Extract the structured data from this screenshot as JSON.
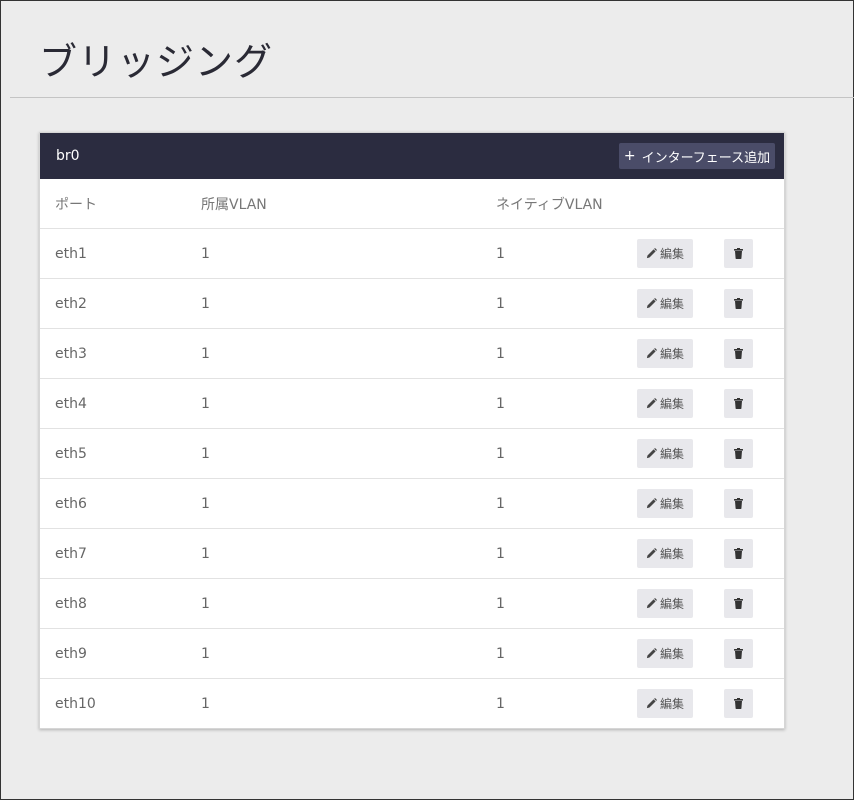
{
  "page": {
    "title": "ブリッジング"
  },
  "bridge": {
    "name": "br0",
    "add_button": {
      "plus": "+",
      "label": "インターフェース追加"
    },
    "columns": {
      "port": "ポート",
      "vlan": "所属VLAN",
      "native_vlan": "ネイティブVLAN"
    },
    "edit_label": "編集",
    "rows": [
      {
        "port": "eth1",
        "vlan": "1",
        "native_vlan": "1"
      },
      {
        "port": "eth2",
        "vlan": "1",
        "native_vlan": "1"
      },
      {
        "port": "eth3",
        "vlan": "1",
        "native_vlan": "1"
      },
      {
        "port": "eth4",
        "vlan": "1",
        "native_vlan": "1"
      },
      {
        "port": "eth5",
        "vlan": "1",
        "native_vlan": "1"
      },
      {
        "port": "eth6",
        "vlan": "1",
        "native_vlan": "1"
      },
      {
        "port": "eth7",
        "vlan": "1",
        "native_vlan": "1"
      },
      {
        "port": "eth8",
        "vlan": "1",
        "native_vlan": "1"
      },
      {
        "port": "eth9",
        "vlan": "1",
        "native_vlan": "1"
      },
      {
        "port": "eth10",
        "vlan": "1",
        "native_vlan": "1"
      }
    ]
  },
  "icons": {
    "edit": "pencil-icon",
    "delete": "trash-icon"
  },
  "colors": {
    "header_bg": "#2b2c40",
    "add_button_bg": "#4a4c68",
    "action_button_bg": "#e8e8ec"
  }
}
